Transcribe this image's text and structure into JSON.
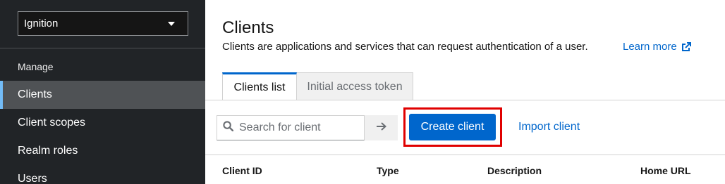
{
  "sidebar": {
    "realm_selector": {
      "value": "Ignition"
    },
    "group_title": "Manage",
    "items": [
      {
        "label": "Clients",
        "active": true
      },
      {
        "label": "Client scopes",
        "active": false
      },
      {
        "label": "Realm roles",
        "active": false
      },
      {
        "label": "Users",
        "active": false
      }
    ]
  },
  "header": {
    "title": "Clients",
    "description": "Clients are applications and services that can request authentication of a user.",
    "learn_more": "Learn more",
    "learn_more_icon": "external-link-icon"
  },
  "tabs": [
    {
      "label": "Clients list",
      "active": true
    },
    {
      "label": "Initial access token",
      "active": false
    }
  ],
  "toolbar": {
    "search_placeholder": "Search for client",
    "search_icon": "search-icon",
    "submit_icon": "arrow-right-icon",
    "create_label": "Create client",
    "import_label": "Import client"
  },
  "table": {
    "columns": [
      "Client ID",
      "Type",
      "Description",
      "Home URL"
    ]
  },
  "colors": {
    "sidebar_bg": "#212427",
    "primary": "#0066cc",
    "highlight": "#e00000"
  }
}
